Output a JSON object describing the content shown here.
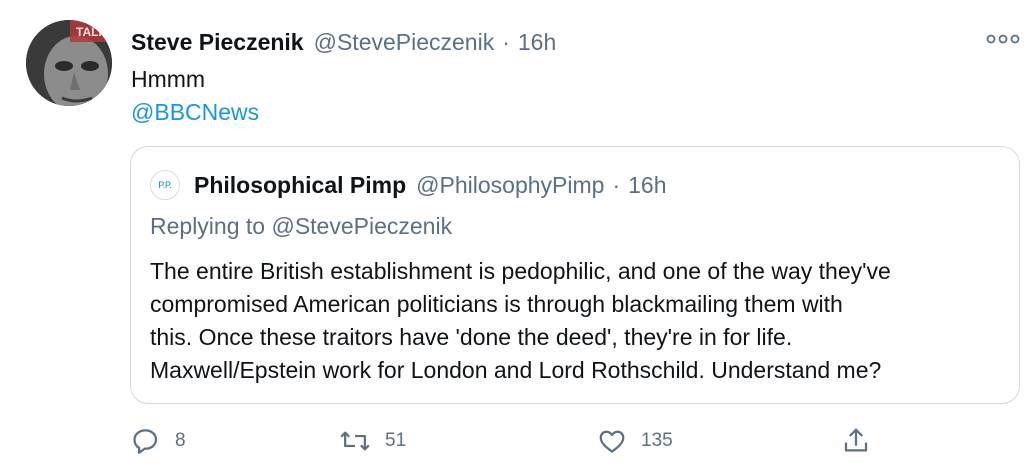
{
  "tweet": {
    "author_name": "Steve Pieczenik",
    "author_handle": "@StevePieczenik",
    "separator": "·",
    "time": "16h",
    "text_line1": "Hmmm",
    "text_line2": "@BBCNews",
    "avatar_badge_text": "TALK"
  },
  "quoted": {
    "avatar_text": "P.P.",
    "author_name": "Philosophical Pimp",
    "author_handle": "@PhilosophyPimp",
    "separator": "·",
    "time": "16h",
    "reply_prefix": "Replying to",
    "reply_mention": "@StevePieczenik",
    "body_lines": [
      "The entire British establishment is pedophilic, and one of the way they've",
      "compromised American politicians is through blackmailing them with",
      "this. Once these traitors have 'done the deed', they're in for life.",
      "Maxwell/Epstein work for London and Lord Rothschild. Understand me?"
    ]
  },
  "actions": {
    "reply_count": "8",
    "retweet_count": "51",
    "like_count": "135"
  },
  "icons": {
    "more": "more-icon",
    "reply": "reply-icon",
    "retweet": "retweet-icon",
    "like": "like-icon",
    "share": "share-icon"
  },
  "colors": {
    "link": "#1b95e0",
    "secondary_text": "#5b7083",
    "border": "#cfd9de"
  }
}
